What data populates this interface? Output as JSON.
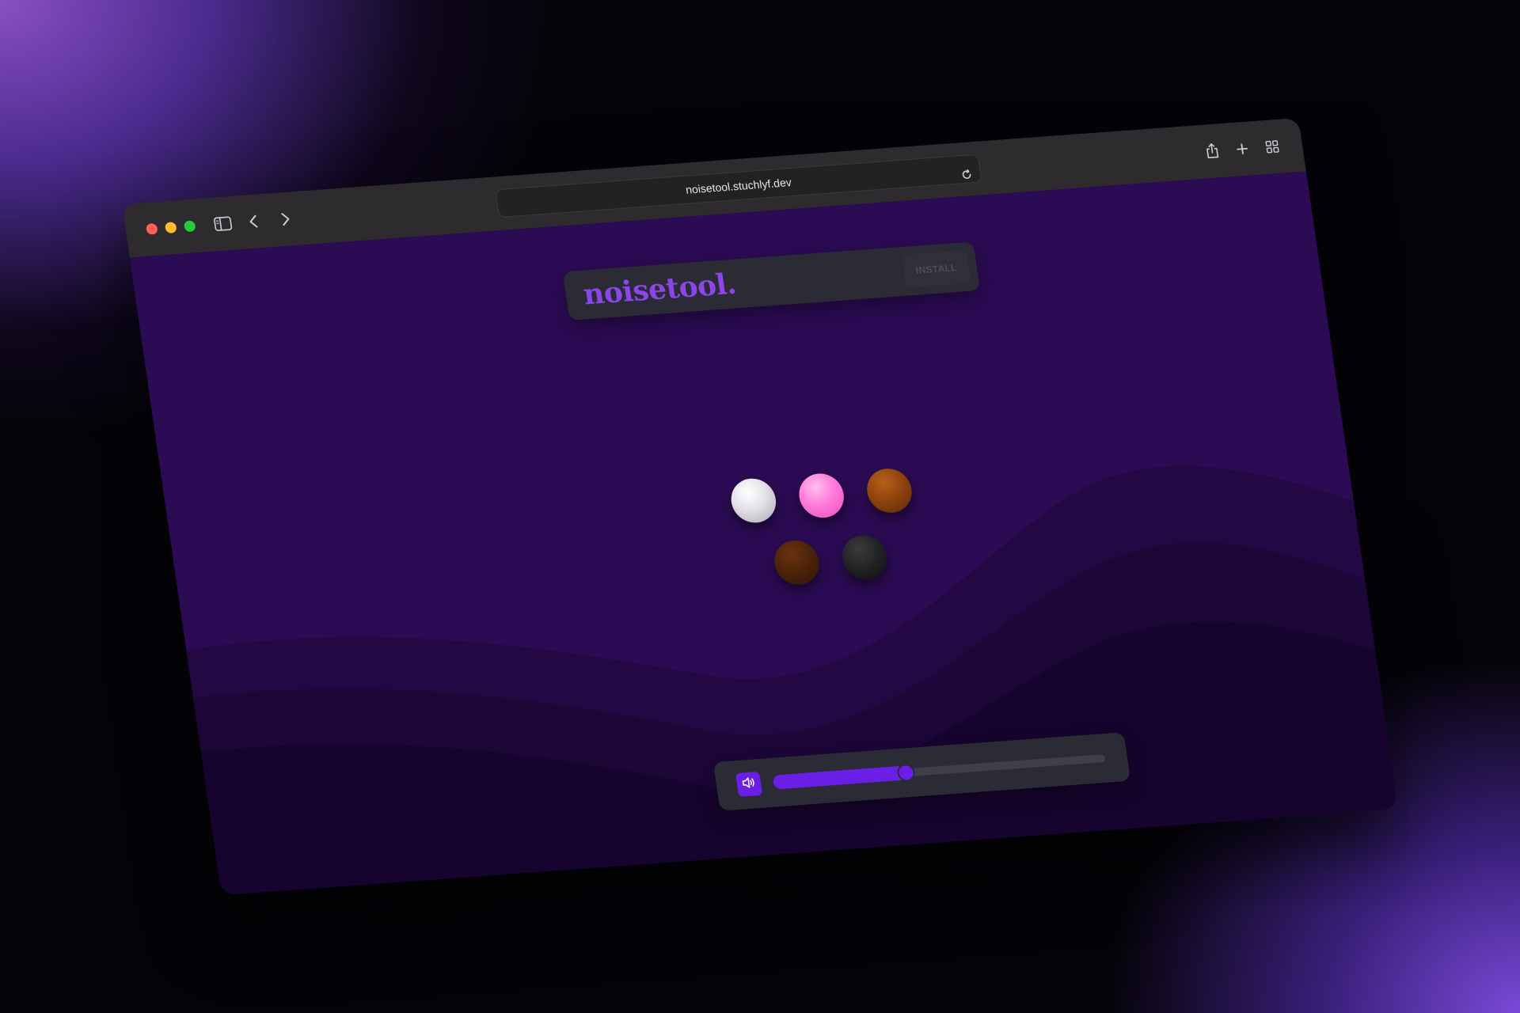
{
  "browser": {
    "url": "noisetool.stuchlyf.dev",
    "window_controls": [
      "close",
      "minimize",
      "zoom"
    ],
    "toolbar_icons": [
      "sidebar-icon",
      "back-icon",
      "forward-icon",
      "reload-icon",
      "share-icon",
      "new-tab-icon",
      "tab-overview-icon"
    ]
  },
  "app": {
    "logo": "noisetool.",
    "install_label": "INSTALL",
    "noise_colors": [
      {
        "name": "white-noise",
        "color": "#e2e0e6"
      },
      {
        "name": "pink-noise",
        "color": "#ff7ad9"
      },
      {
        "name": "brown-noise",
        "color": "#8a420c"
      },
      {
        "name": "dark-brown-noise",
        "color": "#4a220a"
      },
      {
        "name": "black-noise",
        "color": "#222224"
      }
    ],
    "volume": {
      "icon": "speaker-icon",
      "level": 0.4
    }
  },
  "theme": {
    "background": "#2b0b53",
    "accent": "#6a1ee6",
    "logo_color": "#8b45e8",
    "panel": "#2b2b35"
  }
}
